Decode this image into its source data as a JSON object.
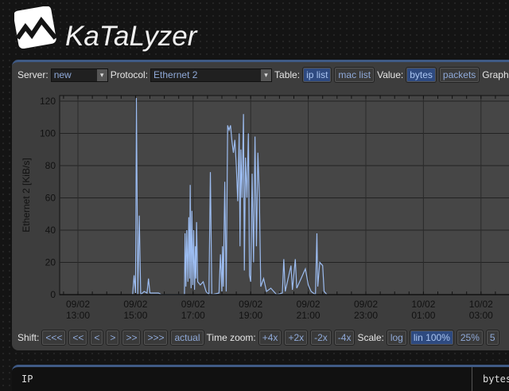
{
  "app": {
    "title": "KaTaLyzer"
  },
  "toolbar": {
    "server_label": "Server:",
    "server_value": "new",
    "protocol_label": "Protocol:",
    "protocol_value": "Ethernet 2",
    "table_label": "Table:",
    "table_options": [
      "ip list",
      "mac list"
    ],
    "value_label": "Value:",
    "value_options": [
      "bytes",
      "packets"
    ],
    "graph_label": "Graph"
  },
  "controls": {
    "shift_label": "Shift:",
    "shift_buttons": [
      "<<<",
      "<<",
      "<",
      ">",
      ">>",
      ">>>",
      "actual"
    ],
    "zoom_label": "Time zoom:",
    "zoom_buttons": [
      "+4x",
      "+2x",
      "-2x",
      "-4x"
    ],
    "scale_label": "Scale:",
    "scale_buttons": [
      "log",
      "lin 100%",
      "25%",
      "5"
    ]
  },
  "table": {
    "headers": [
      "IP",
      "bytes"
    ]
  },
  "chart_data": {
    "type": "line",
    "ylabel": "Ethernet 2 [KiB/s]",
    "ylim": [
      0,
      120
    ],
    "yticks": [
      0,
      20,
      40,
      60,
      80,
      100,
      120
    ],
    "xticks": [
      {
        "h": 0,
        "l1": "09/02",
        "l2": "13:00"
      },
      {
        "h": 2,
        "l1": "09/02",
        "l2": "15:00"
      },
      {
        "h": 4,
        "l1": "09/02",
        "l2": "17:00"
      },
      {
        "h": 6,
        "l1": "09/02",
        "l2": "19:00"
      },
      {
        "h": 8,
        "l1": "09/02",
        "l2": "21:00"
      },
      {
        "h": 10,
        "l1": "09/02",
        "l2": "23:00"
      },
      {
        "h": 12,
        "l1": "10/02",
        "l2": "01:00"
      },
      {
        "h": 14,
        "l1": "10/02",
        "l2": "03:00"
      }
    ],
    "x_unit": "hours since 09/02 13:00",
    "color": "#9cbcf0",
    "series": [
      [
        1.9,
        0
      ],
      [
        1.95,
        12
      ],
      [
        2.0,
        1
      ],
      [
        2.03,
        122
      ],
      [
        2.08,
        0
      ],
      [
        2.13,
        49
      ],
      [
        2.18,
        0
      ],
      [
        2.3,
        2
      ],
      [
        2.4,
        1
      ],
      [
        2.45,
        10
      ],
      [
        2.5,
        1
      ],
      [
        2.8,
        1
      ],
      [
        2.9,
        0
      ],
      [
        3.7,
        0
      ],
      [
        3.72,
        38
      ],
      [
        3.75,
        5
      ],
      [
        3.78,
        40
      ],
      [
        3.82,
        8
      ],
      [
        3.85,
        48
      ],
      [
        3.88,
        10
      ],
      [
        3.9,
        68
      ],
      [
        3.93,
        4
      ],
      [
        3.96,
        52
      ],
      [
        3.99,
        6
      ],
      [
        4.02,
        40
      ],
      [
        4.05,
        3
      ],
      [
        4.08,
        30
      ],
      [
        4.1,
        10
      ],
      [
        4.12,
        45
      ],
      [
        4.16,
        8
      ],
      [
        4.25,
        6
      ],
      [
        4.35,
        8
      ],
      [
        4.45,
        2
      ],
      [
        4.55,
        0
      ],
      [
        4.6,
        76
      ],
      [
        4.65,
        0
      ],
      [
        4.9,
        1
      ],
      [
        4.95,
        25
      ],
      [
        5.0,
        2
      ],
      [
        5.02,
        30
      ],
      [
        5.05,
        5
      ],
      [
        5.1,
        70
      ],
      [
        5.15,
        2
      ],
      [
        5.2,
        105
      ],
      [
        5.25,
        102
      ],
      [
        5.3,
        105
      ],
      [
        5.35,
        95
      ],
      [
        5.4,
        88
      ],
      [
        5.45,
        96
      ],
      [
        5.5,
        80
      ],
      [
        5.55,
        58
      ],
      [
        5.6,
        100
      ],
      [
        5.63,
        30
      ],
      [
        5.66,
        90
      ],
      [
        5.7,
        60
      ],
      [
        5.75,
        112
      ],
      [
        5.78,
        15
      ],
      [
        5.82,
        85
      ],
      [
        5.87,
        60
      ],
      [
        5.92,
        100
      ],
      [
        5.96,
        12
      ],
      [
        6.0,
        8
      ],
      [
        6.05,
        75
      ],
      [
        6.1,
        20
      ],
      [
        6.15,
        98
      ],
      [
        6.2,
        30
      ],
      [
        6.25,
        88
      ],
      [
        6.3,
        62
      ],
      [
        6.35,
        5
      ],
      [
        6.45,
        10
      ],
      [
        6.55,
        2
      ],
      [
        6.7,
        4
      ],
      [
        6.9,
        0
      ],
      [
        7.1,
        1
      ],
      [
        7.15,
        22
      ],
      [
        7.2,
        2
      ],
      [
        7.4,
        18
      ],
      [
        7.45,
        3
      ],
      [
        7.55,
        22
      ],
      [
        7.6,
        4
      ],
      [
        7.8,
        12
      ],
      [
        7.9,
        16
      ],
      [
        8.0,
        6
      ],
      [
        8.1,
        2
      ],
      [
        8.25,
        0
      ],
      [
        8.3,
        38
      ],
      [
        8.33,
        5
      ],
      [
        8.4,
        20
      ],
      [
        8.5,
        18
      ],
      [
        8.55,
        2
      ],
      [
        8.65,
        0
      ]
    ]
  }
}
